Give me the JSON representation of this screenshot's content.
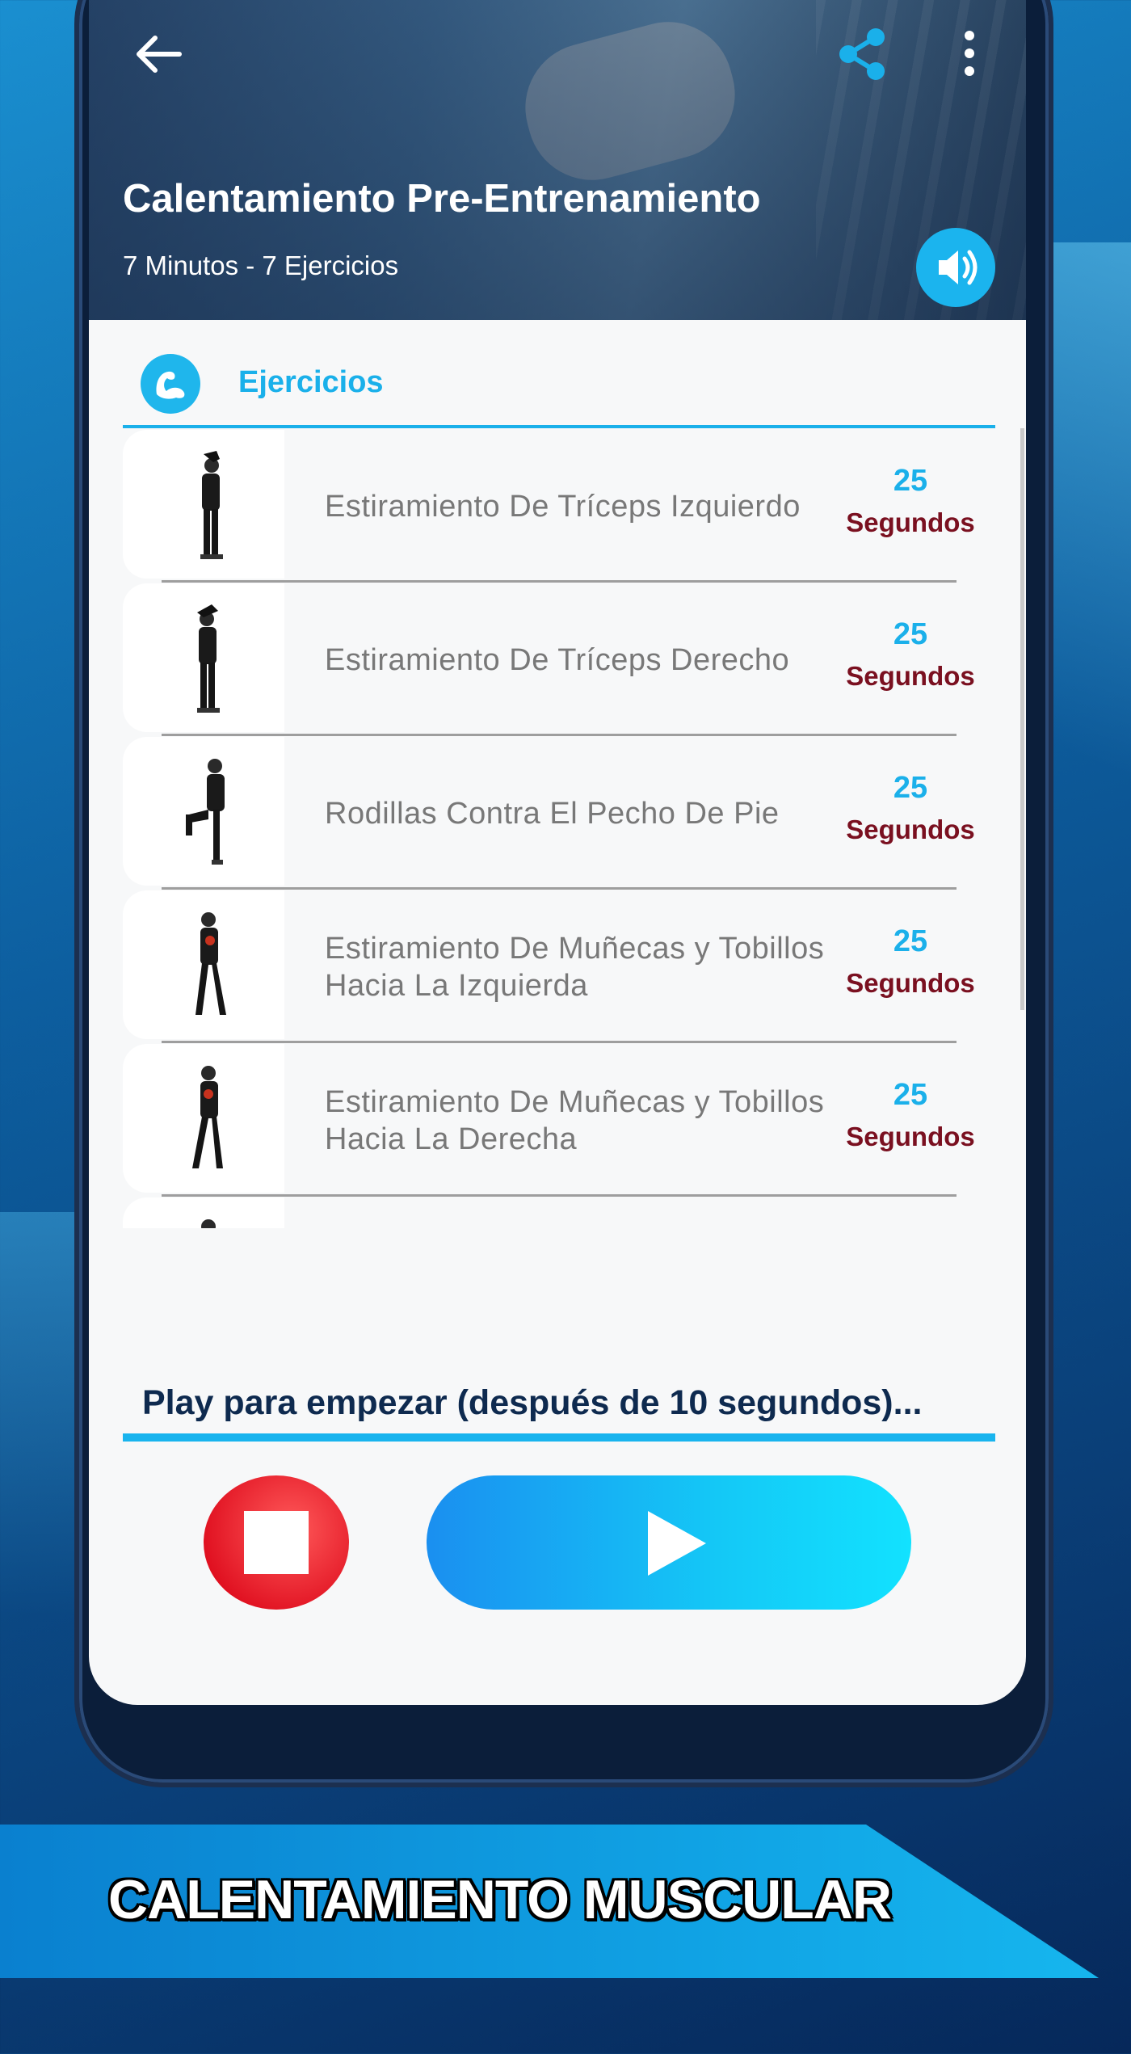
{
  "header": {
    "title": "Calentamiento Pre-Entrenamiento",
    "subtitle": "7 Minutos - 7 Ejercicios",
    "back_icon": "arrow-left-icon",
    "share_icon": "share-icon",
    "more_icon": "more-vertical-icon",
    "sound_icon": "speaker-icon"
  },
  "section": {
    "icon": "muscle-icon",
    "title": "Ejercicios"
  },
  "exercises": [
    {
      "name": "Estiramiento De Tríceps Izquierdo",
      "duration": "25",
      "unit": "Segundos"
    },
    {
      "name": "Estiramiento De Tríceps Derecho",
      "duration": "25",
      "unit": "Segundos"
    },
    {
      "name": "Rodillas Contra El Pecho De Pie",
      "duration": "25",
      "unit": "Segundos"
    },
    {
      "name": "Estiramiento De Muñecas y Tobillos Hacia La Izquierda",
      "duration": "25",
      "unit": "Segundos"
    },
    {
      "name": "Estiramiento De Muñecas y Tobillos Hacia La Derecha",
      "duration": "25",
      "unit": "Segundos"
    }
  ],
  "controls": {
    "status_text": "Play para empezar (después de 10 segundos)...",
    "stop_icon": "stop-icon",
    "play_icon": "play-icon"
  },
  "banner": {
    "text": "CALENTAMIENTO MUSCULAR"
  },
  "colors": {
    "accent": "#1ab0ea",
    "unit_text": "#7a1020",
    "stop_button": "#e01020",
    "title_dark": "#0e2a4f"
  }
}
